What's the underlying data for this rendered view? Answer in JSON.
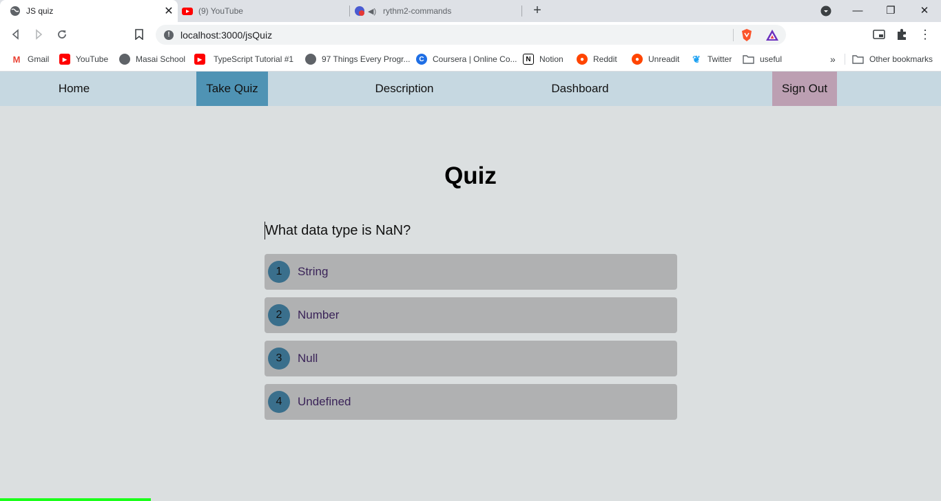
{
  "browser": {
    "tabs": [
      {
        "title": "JS quiz",
        "active": true
      },
      {
        "title": "(9) YouTube",
        "active": false
      },
      {
        "title": "rythm2-commands",
        "active": false
      }
    ],
    "url": "localhost:3000/jsQuiz",
    "bookmarks": [
      {
        "label": "Gmail",
        "icon": "gmail-icon"
      },
      {
        "label": "YouTube",
        "icon": "youtube-icon"
      },
      {
        "label": "Masai School",
        "icon": "globe-icon"
      },
      {
        "label": "TypeScript Tutorial #1",
        "icon": "youtube-icon"
      },
      {
        "label": "97 Things Every Progr...",
        "icon": "globe-icon"
      },
      {
        "label": "Coursera | Online Co...",
        "icon": "coursera-icon"
      },
      {
        "label": "Notion",
        "icon": "notion-icon"
      },
      {
        "label": "Reddit",
        "icon": "reddit-icon"
      },
      {
        "label": "Unreadit",
        "icon": "unreadit-icon"
      },
      {
        "label": "Twitter",
        "icon": "twitter-icon"
      },
      {
        "label": "useful",
        "icon": "folder-icon"
      }
    ],
    "more_bookmarks": "»",
    "other_bookmarks": "Other bookmarks"
  },
  "nav": {
    "home": "Home",
    "take_quiz": "Take Quiz",
    "description": "Description",
    "dashboard": "Dashboard",
    "sign_out": "Sign Out"
  },
  "quiz": {
    "title": "Quiz",
    "question": "What data type is NaN?",
    "options": [
      {
        "num": "1",
        "label": "String"
      },
      {
        "num": "2",
        "label": "Number"
      },
      {
        "num": "3",
        "label": "Null"
      },
      {
        "num": "4",
        "label": "Undefined"
      }
    ],
    "progress_fraction": 0.16
  },
  "colors": {
    "nav_bg": "#c6d8e1",
    "nav_active": "#4f93b4",
    "sign_out_bg": "#bc9fb2",
    "page_bg": "#dbdfe0",
    "option_bg": "#b0b1b2",
    "option_num_bg": "#3a6f8c",
    "option_text": "#3a2358",
    "progress": "#1aff1a"
  }
}
